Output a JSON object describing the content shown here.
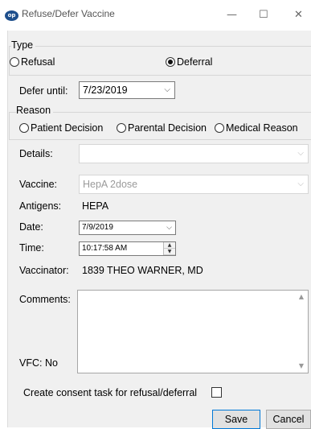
{
  "window": {
    "title": "Refuse/Defer Vaccine",
    "icon_label": "op",
    "icon_color": "#1e4f8c",
    "controls": {
      "minimize": "—",
      "maximize": "☐",
      "close": "✕"
    }
  },
  "type_group": {
    "label": "Type",
    "options": [
      {
        "label": "Refusal",
        "selected": false
      },
      {
        "label": "Deferral",
        "selected": true
      }
    ]
  },
  "defer": {
    "label": "Defer until:",
    "value": "7/23/2019"
  },
  "reason_group": {
    "label": "Reason",
    "options": [
      {
        "label": "Patient Decision",
        "selected": false
      },
      {
        "label": "Parental Decision",
        "selected": false
      },
      {
        "label": "Medical Reason",
        "selected": false
      }
    ]
  },
  "details": {
    "label": "Details:",
    "value": ""
  },
  "vaccine": {
    "label": "Vaccine:",
    "value": "HepA 2dose"
  },
  "antigens": {
    "label": "Antigens:",
    "value": "HEPA"
  },
  "date": {
    "label": "Date:",
    "value": "7/9/2019"
  },
  "time": {
    "label": "Time:",
    "value": "10:17:58 AM"
  },
  "vaccinator": {
    "label": "Vaccinator:",
    "value": "1839 THEO WARNER, MD"
  },
  "comments": {
    "label": "Comments:",
    "value": ""
  },
  "vfc": {
    "label": "VFC: No"
  },
  "consent": {
    "label": "Create consent task for refusal/deferral",
    "checked": false
  },
  "buttons": {
    "save": "Save",
    "cancel": "Cancel"
  },
  "icons": {
    "chevron": "⌵",
    "radio": "radio-button",
    "spin_up": "▲",
    "spin_down": "▼",
    "scroll_up": "▲",
    "scroll_down": "▼"
  }
}
